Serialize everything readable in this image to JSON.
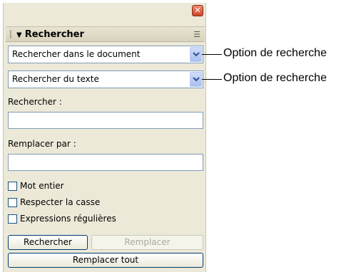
{
  "panel": {
    "title": "Rechercher",
    "collapse_glyph": "▼",
    "close_glyph": "✕",
    "options_glyph": "☰"
  },
  "dropdowns": {
    "scope": "Rechercher dans le document",
    "type": "Rechercher du texte"
  },
  "fields": {
    "search_label": "Rechercher :",
    "search_value": "",
    "replace_label": "Remplacer par :",
    "replace_value": ""
  },
  "checkboxes": {
    "whole_word": "Mot entier",
    "match_case": "Respecter la casse",
    "regex": "Expressions régulières"
  },
  "buttons": {
    "search": "Rechercher",
    "replace": "Remplacer",
    "replace_all": "Remplacer tout"
  },
  "callouts": {
    "first": "Option de recherche",
    "second": "Option de recherche"
  }
}
